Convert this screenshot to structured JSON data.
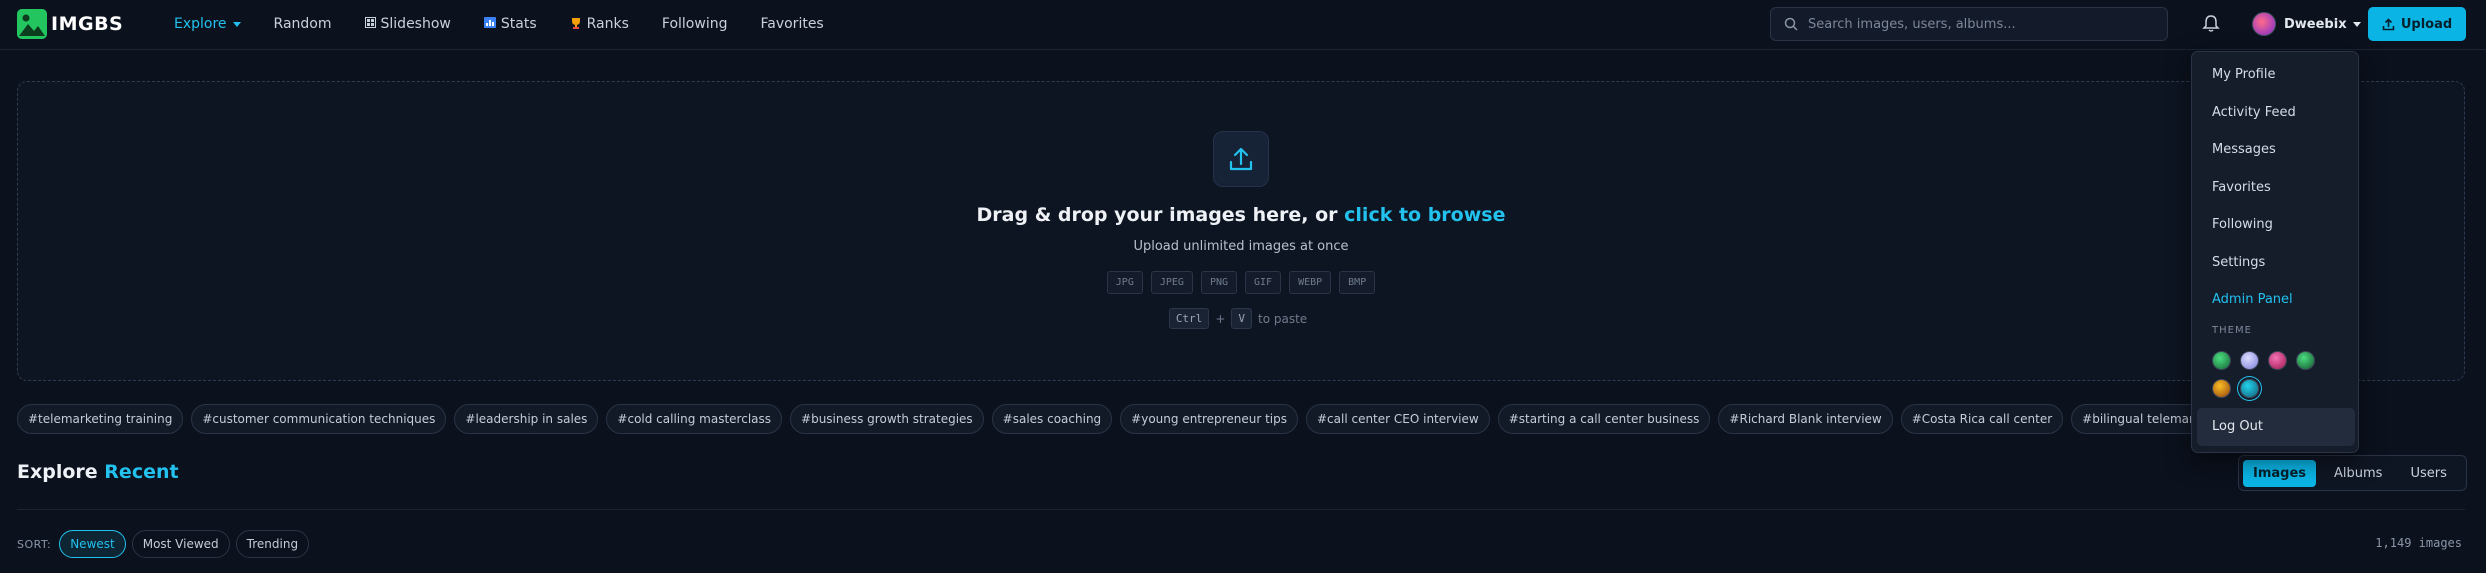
{
  "brand": {
    "name": "IMGBS"
  },
  "nav": [
    {
      "label": "Explore",
      "icon": "",
      "active": true
    },
    {
      "label": "Random",
      "icon": ""
    },
    {
      "label": "Slideshow",
      "icon": "slideshow-icon"
    },
    {
      "label": "Stats",
      "icon": "stats-icon"
    },
    {
      "label": "Ranks",
      "icon": "trophy-icon"
    },
    {
      "label": "Following",
      "icon": ""
    },
    {
      "label": "Favorites",
      "icon": ""
    }
  ],
  "search": {
    "placeholder": "Search images, users, albums..."
  },
  "user": {
    "name": "Dweebix"
  },
  "upload_label": "Upload",
  "dropzone": {
    "title_prefix": "Drag & drop your images here, or ",
    "title_link": "click to browse",
    "subtitle": "Upload unlimited images at once",
    "formats": [
      "JPG",
      "JPEG",
      "PNG",
      "GIF",
      "WEBP",
      "BMP"
    ],
    "paste_key1": "Ctrl",
    "paste_plus": "+",
    "paste_key2": "V",
    "paste_text": "to paste"
  },
  "tags": [
    "#telemarketing training",
    "#customer communication techniques",
    "#leadership in sales",
    "#cold calling masterclass",
    "#business growth strategies",
    "#sales coaching",
    "#young entrepreneur tips",
    "#call center CEO interview",
    "#starting a call center business",
    "#Richard Blank interview",
    "#Costa Rica call center",
    "#bilingual telemarketing"
  ],
  "explore": {
    "title": "Explore",
    "accent": "Recent",
    "tabs": [
      "Images",
      "Albums",
      "Users"
    ],
    "active_tab": "Images"
  },
  "sort": {
    "label": "SORT:",
    "options": [
      "Newest",
      "Most Viewed",
      "Trending"
    ],
    "active": "Newest",
    "count": "1,149 images"
  },
  "menu": {
    "items": [
      "My Profile",
      "Activity Feed",
      "Messages",
      "Favorites",
      "Following",
      "Settings"
    ],
    "admin": "Admin Panel",
    "theme_label": "THEME",
    "logout": "Log Out",
    "theme_swatches": [
      "#16a34a",
      "#a5a6f0",
      "#d21f6b",
      "#15a34a",
      "#d97706",
      "#0891b2"
    ],
    "selected_swatch": 5
  },
  "colors": {
    "accent": "#22c1ee",
    "background": "#0b111d",
    "logo": "#22c55e"
  }
}
